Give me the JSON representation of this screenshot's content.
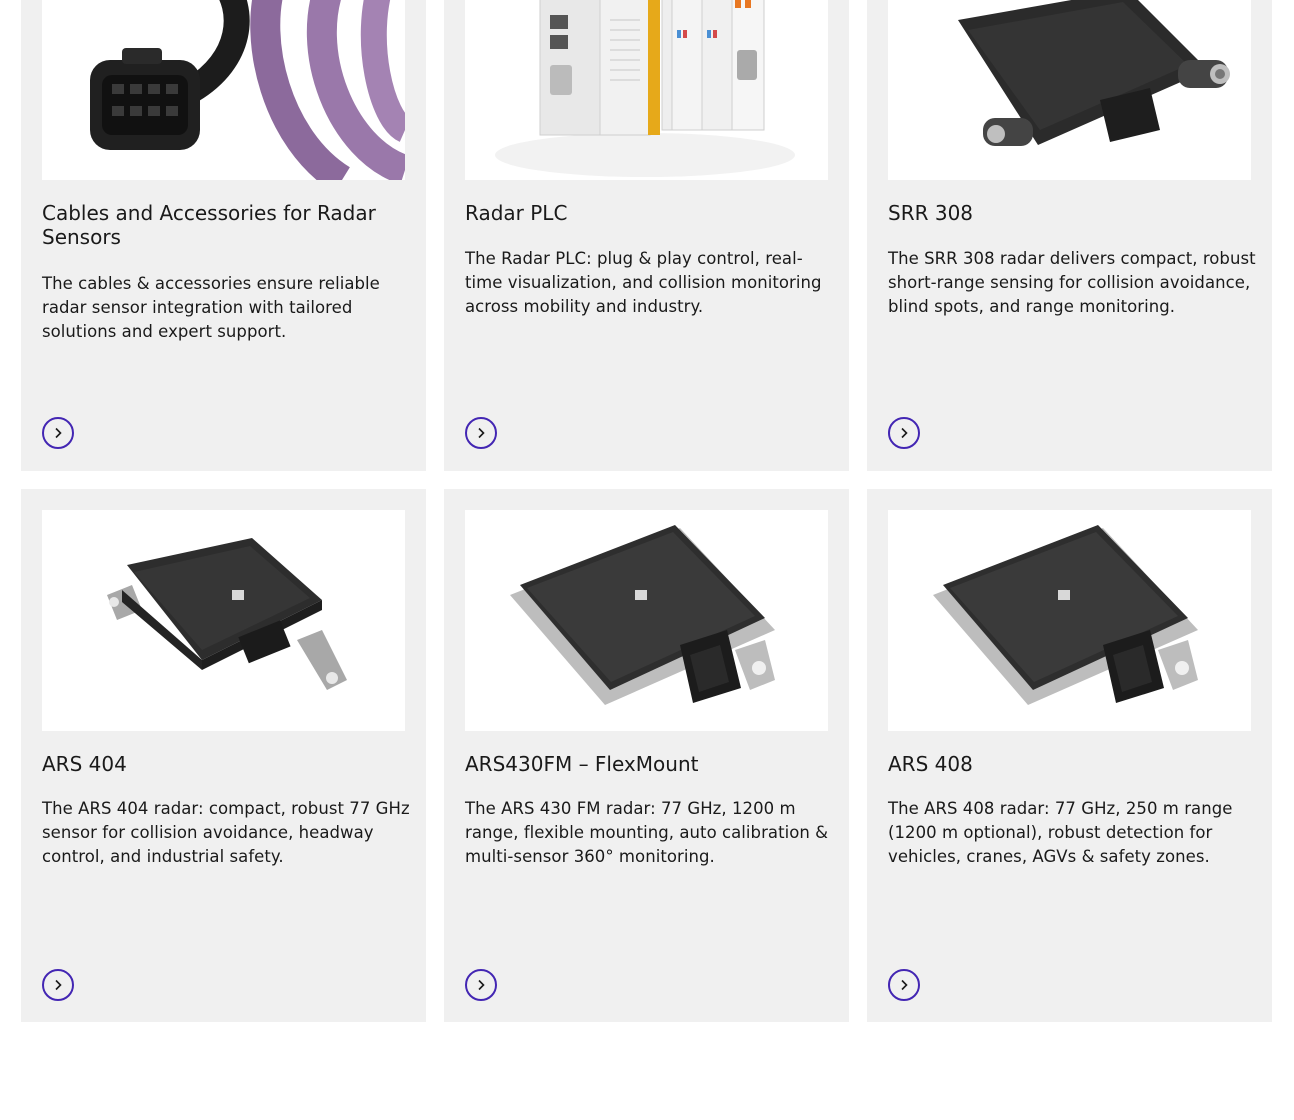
{
  "cards": [
    {
      "title": "Cables and Accessories for Radar Sensors",
      "description": "The cables & accessories ensure reliable radar sensor integration with tailored solutions and expert support.",
      "image": "radar-cable-connector-image"
    },
    {
      "title": "Radar PLC",
      "description": "The Radar PLC: plug & play control, real-time visualization, and collision monitoring across mobility and industry.",
      "image": "radar-plc-modules-image"
    },
    {
      "title": "SRR 308",
      "description": "The SRR 308 radar delivers compact, robust short-range sensing for collision avoidance, blind spots, and range monitoring.",
      "image": "srr-308-sensor-image"
    },
    {
      "title": "ARS 404",
      "description": "The ARS 404 radar: compact, robust 77 GHz sensor for collision avoidance, headway control, and industrial safety.",
      "image": "ars-404-sensor-image"
    },
    {
      "title": "ARS430FM – FlexMount",
      "description": "The ARS 430 FM radar: 77 GHz, 1200 m range, flexible mounting, auto calibration & multi-sensor 360° monitoring.",
      "image": "ars430fm-sensor-image"
    },
    {
      "title": "ARS 408",
      "description": "The ARS 408 radar: 77 GHz, 250 m range (1200 m optional), robust detection for vehicles, cranes, AGVs & safety zones.",
      "image": "ars-408-sensor-image"
    }
  ],
  "colors": {
    "card_background": "#f0f0f0",
    "accent": "#4326b3"
  }
}
